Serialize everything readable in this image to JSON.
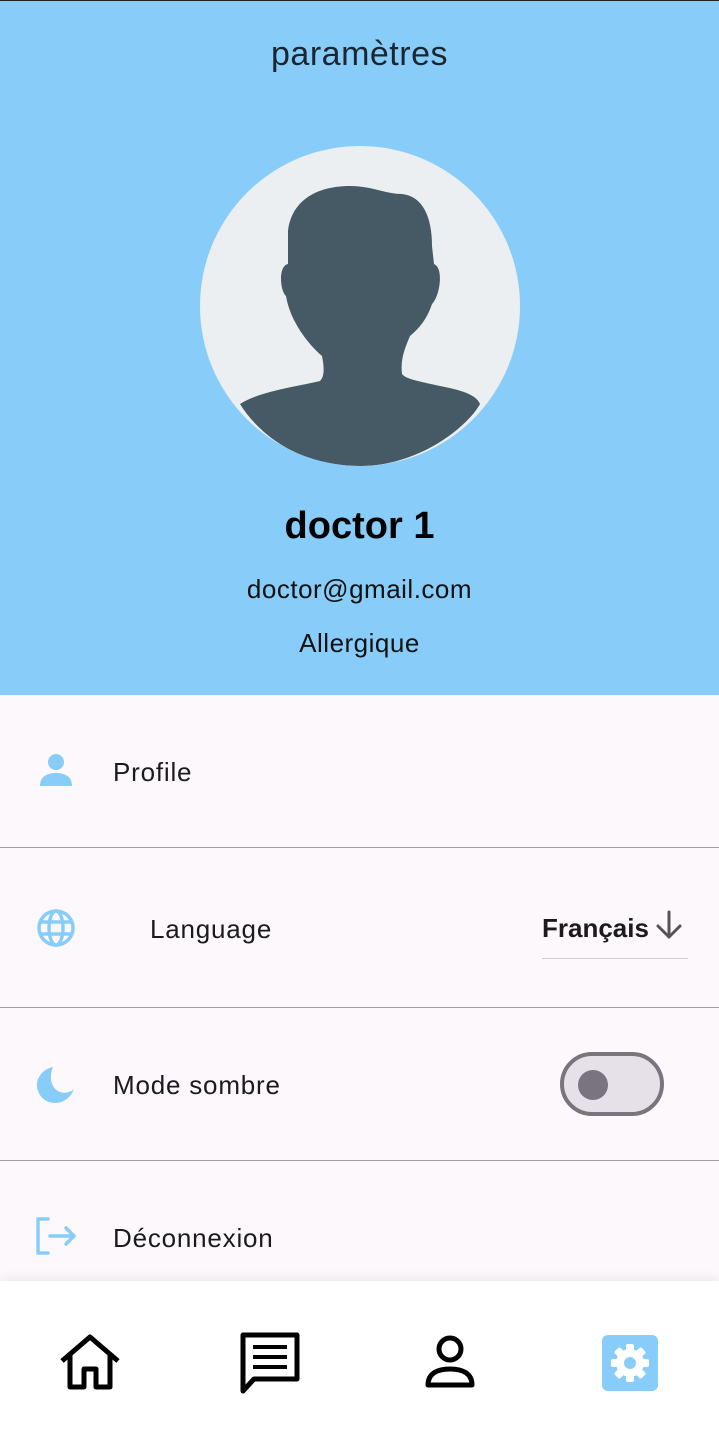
{
  "header": {
    "title": "paramètres",
    "user_name": "doctor 1",
    "email": "doctor@gmail.com",
    "condition": "Allergique"
  },
  "settings": {
    "profile_label": "Profile",
    "language_label": "Language",
    "language_value": "Français",
    "dark_mode_label": "Mode sombre",
    "dark_mode_on": false,
    "logout_label": "Déconnexion"
  },
  "bottom_nav": {
    "items": [
      "home-icon",
      "chat-icon",
      "person-icon",
      "settings-icon"
    ],
    "active_index": 3
  },
  "colors": {
    "header_bg": "#88cdf9",
    "accent": "#88cdf9",
    "avatar_bg": "#eceff1",
    "avatar_silhouette": "#455a64"
  }
}
